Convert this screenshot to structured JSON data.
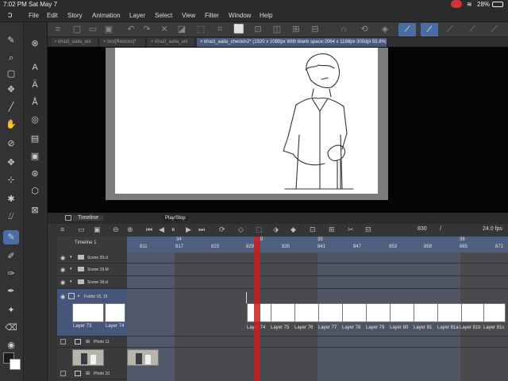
{
  "status_bar": {
    "time": "7:02 PM",
    "date": "Sat May 7",
    "battery": "28%"
  },
  "menu": {
    "items": [
      "File",
      "Edit",
      "Story",
      "Animation",
      "Layer",
      "Select",
      "View",
      "Filter",
      "Window",
      "Help"
    ]
  },
  "document_tabs": [
    {
      "label": "khazi_aaila_ani",
      "active": false
    },
    {
      "label": "test[Restore]*",
      "active": false
    },
    {
      "label": "khazi_aaila_ani",
      "active": false
    },
    {
      "label": "khazi_aaila_checkin2* (1920 x 1080px With blank space:2064 x 1188px 300dpi 55.8%)",
      "active": true
    }
  ],
  "timeline": {
    "panel_title": "Timeline",
    "tooltip": "Play/Stop",
    "name": "Timeline 1",
    "current_frame": "830",
    "slash": "/",
    "fps": "24.0 fps",
    "marker_top": [
      "34",
      "830",
      "35",
      "36"
    ],
    "ruler_ticks": [
      "811",
      "817",
      "823",
      "829",
      "835",
      "841",
      "847",
      "853",
      "859",
      "865",
      "871"
    ]
  },
  "layers": [
    {
      "name": "Scene 20.cl"
    },
    {
      "name": "Scene 19.M"
    },
    {
      "name": "Scene 18.cl"
    },
    {
      "name": "Folder 15, 15"
    },
    {
      "name": "Photo 11"
    },
    {
      "name": "Photo 10"
    }
  ],
  "frame_labels": {
    "left": [
      "Layer 73",
      "Layer 74"
    ],
    "right": [
      "Layer 74",
      "Layer 75",
      "Layer 76",
      "Layer 77",
      "Layer 78",
      "Layer 79",
      "Layer 80",
      "Layer 81",
      "Layer 81a",
      "Layer 81b",
      "Layer 81c"
    ]
  },
  "colors": {
    "accent": "#4a6ea3",
    "playhead": "#c41f1f",
    "ruler": "#4f5f80"
  }
}
